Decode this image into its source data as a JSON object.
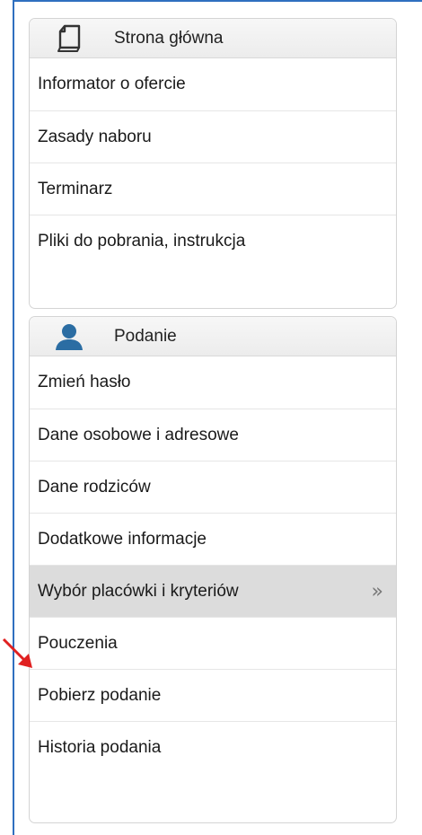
{
  "sections": [
    {
      "title": "Strona główna",
      "icon": "document-icon",
      "items": [
        {
          "label": "Informator o ofercie"
        },
        {
          "label": "Zasady naboru"
        },
        {
          "label": "Terminarz"
        },
        {
          "label": "Pliki do pobrania, instrukcja"
        }
      ]
    },
    {
      "title": "Podanie",
      "icon": "user-icon",
      "items": [
        {
          "label": "Zmień hasło"
        },
        {
          "label": "Dane osobowe i adresowe"
        },
        {
          "label": "Dane rodziców"
        },
        {
          "label": "Dodatkowe informacje"
        },
        {
          "label": "Wybór placówki i kryteriów",
          "active": true,
          "chevron": "»"
        },
        {
          "label": "Pouczenia"
        },
        {
          "label": "Pobierz podanie"
        },
        {
          "label": "Historia podania"
        }
      ]
    }
  ],
  "colors": {
    "frame_border": "#2f6fbf",
    "active_item_bg": "#dcdcdc",
    "user_icon": "#2b6da3",
    "annotation_arrow": "#e02020"
  }
}
